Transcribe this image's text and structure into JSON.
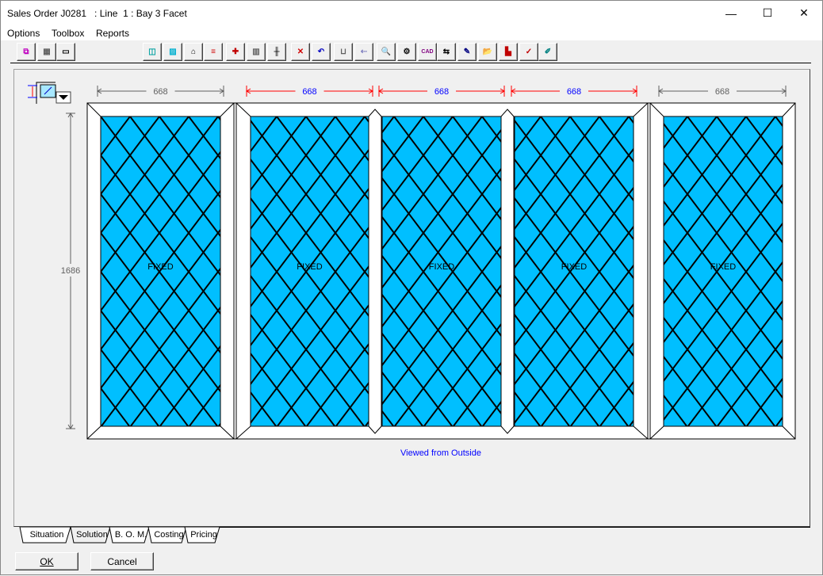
{
  "window": {
    "title": "Sales Order J0281   : Line  1 : Bay 3 Facet"
  },
  "menu": [
    {
      "label": "Options"
    },
    {
      "label": "Toolbox"
    },
    {
      "label": "Reports"
    }
  ],
  "toolbar": [
    {
      "icon": "add-frame-icon",
      "glyph": "⧉",
      "color": "#c000c0"
    },
    {
      "icon": "grid-icon",
      "glyph": "▦",
      "color": "#606060"
    },
    {
      "icon": "mullion-icon",
      "glyph": "▭",
      "color": "#000"
    },
    {
      "icon": "sash-icon",
      "glyph": "◫",
      "color": "#00a0a0"
    },
    {
      "icon": "glass-icon",
      "glyph": "▨",
      "color": "#00b0d0"
    },
    {
      "icon": "handle-icon",
      "glyph": "⌂",
      "color": "#000"
    },
    {
      "icon": "list-icon",
      "glyph": "≡",
      "color": "#d00000"
    },
    {
      "icon": "colour-icon",
      "glyph": "✚",
      "color": "#c00000"
    },
    {
      "icon": "bars-icon",
      "glyph": "▥",
      "color": "#606060"
    },
    {
      "icon": "transom-icon",
      "glyph": "╫",
      "color": "#000"
    },
    {
      "icon": "delete-icon",
      "glyph": "✕",
      "color": "#d00000"
    },
    {
      "icon": "undo-icon",
      "glyph": "↶",
      "color": "#0000c0"
    },
    {
      "icon": "dimension-icon",
      "glyph": "⊔",
      "color": "#606060"
    },
    {
      "icon": "arrow-icon",
      "glyph": "⇠",
      "color": "#8080c0"
    },
    {
      "icon": "zoom-icon",
      "glyph": "🔍",
      "color": "#008080"
    },
    {
      "icon": "tools-icon",
      "glyph": "⚙",
      "color": "#000"
    },
    {
      "icon": "cad-icon",
      "glyph": "CAD",
      "color": "#800080"
    },
    {
      "icon": "fit-icon",
      "glyph": "⇆",
      "color": "#000"
    },
    {
      "icon": "torch-icon",
      "glyph": "✎",
      "color": "#000080"
    },
    {
      "icon": "open-folder-icon",
      "glyph": "📂",
      "color": "#c0a000"
    },
    {
      "icon": "chart-icon",
      "glyph": "▙",
      "color": "#c00000"
    },
    {
      "icon": "check-icon",
      "glyph": "✓",
      "color": "#c00000"
    },
    {
      "icon": "notes-icon",
      "glyph": "✐",
      "color": "#008080"
    }
  ],
  "drawing": {
    "widths": [
      "668",
      "668",
      "668",
      "668",
      "668"
    ],
    "width_colors": [
      "#606060",
      "#0000ff",
      "#0000ff",
      "#0000ff",
      "#606060"
    ],
    "height": "1686",
    "pane_label": "FIXED",
    "caption": "Viewed from Outside",
    "glass_color": "#00bfff"
  },
  "tabs": [
    {
      "label": "Situation"
    },
    {
      "label": "Solution",
      "active": true
    },
    {
      "label": "B. O. M."
    },
    {
      "label": "Costing"
    },
    {
      "label": "Pricing"
    }
  ],
  "buttons": {
    "ok": "OK",
    "cancel": "Cancel"
  }
}
